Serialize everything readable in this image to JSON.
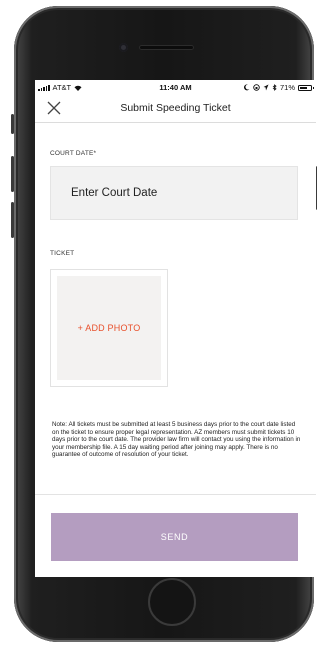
{
  "status_bar": {
    "carrier": "AT&T",
    "time": "11:40 AM",
    "battery_percent": "71%",
    "battery_level": 0.71
  },
  "header": {
    "title": "Submit Speeding Ticket"
  },
  "court_date": {
    "label": "COURT DATE*",
    "placeholder": "Enter Court Date",
    "value": ""
  },
  "ticket": {
    "label": "TICKET",
    "add_photo_label": "+ ADD PHOTO"
  },
  "note": "Note: All tickets must be submitted at least 5 business days prior to the court date listed on the ticket to ensure proper legal representation. AZ members must submit tickets 10 days prior to the court date. The provider law firm will contact you using the information in your membership file. A 15 day waiting period after joining may apply. There is no guarantee of outcome of resolution of your ticket.",
  "send_label": "SEND",
  "colors": {
    "accent_orange": "#e8502c",
    "send_button": "#b49dc0"
  }
}
